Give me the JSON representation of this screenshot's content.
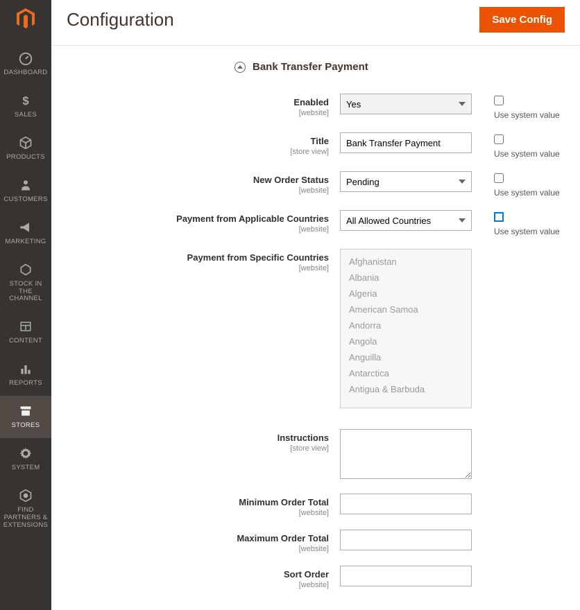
{
  "sidebar": {
    "items": [
      {
        "label": "Dashboard",
        "icon": "dashboard"
      },
      {
        "label": "Sales",
        "icon": "dollar"
      },
      {
        "label": "Products",
        "icon": "cube"
      },
      {
        "label": "Customers",
        "icon": "person"
      },
      {
        "label": "Marketing",
        "icon": "megaphone"
      },
      {
        "label": "Stock in the Channel",
        "icon": "hex"
      },
      {
        "label": "Content",
        "icon": "layout"
      },
      {
        "label": "Reports",
        "icon": "bars"
      },
      {
        "label": "Stores",
        "icon": "store",
        "active": true
      },
      {
        "label": "System",
        "icon": "gear"
      },
      {
        "label": "Find Partners & Extensions",
        "icon": "partners"
      }
    ]
  },
  "header": {
    "title": "Configuration",
    "save_label": "Save Config"
  },
  "section": {
    "title": "Bank Transfer Payment"
  },
  "fields": {
    "enabled": {
      "label": "Enabled",
      "scope": "[website]",
      "value": "Yes",
      "use_system_label": "Use system value"
    },
    "title": {
      "label": "Title",
      "scope": "[store view]",
      "value": "Bank Transfer Payment",
      "use_system_label": "Use system value"
    },
    "new_order_status": {
      "label": "New Order Status",
      "scope": "[website]",
      "value": "Pending",
      "use_system_label": "Use system value"
    },
    "applicable_countries": {
      "label": "Payment from Applicable Countries",
      "scope": "[website]",
      "value": "All Allowed Countries",
      "use_system_label": "Use system value"
    },
    "specific_countries": {
      "label": "Payment from Specific Countries",
      "scope": "[website]",
      "options": [
        "Afghanistan",
        "Albania",
        "Algeria",
        "American Samoa",
        "Andorra",
        "Angola",
        "Anguilla",
        "Antarctica",
        "Antigua & Barbuda"
      ]
    },
    "instructions": {
      "label": "Instructions",
      "scope": "[store view]",
      "value": ""
    },
    "min_order": {
      "label": "Minimum Order Total",
      "scope": "[website]",
      "value": ""
    },
    "max_order": {
      "label": "Maximum Order Total",
      "scope": "[website]",
      "value": ""
    },
    "sort_order": {
      "label": "Sort Order",
      "scope": "[website]",
      "value": ""
    }
  }
}
